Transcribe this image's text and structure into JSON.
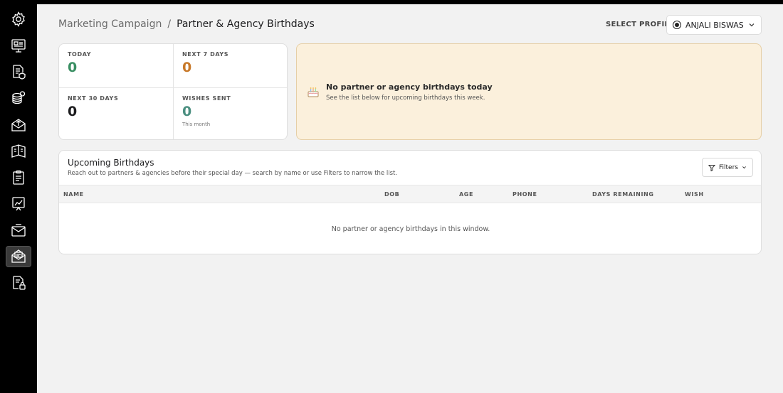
{
  "breadcrumb": {
    "parent": "Marketing Campaign",
    "separator": "/",
    "current": "Partner & Agency Birthdays"
  },
  "profile": {
    "label": "SELECT PROFILE",
    "selected": "ANJALI BISWAS"
  },
  "stats": {
    "today": {
      "label": "TODAY",
      "value": "0"
    },
    "next7": {
      "label": "NEXT 7 DAYS",
      "value": "0"
    },
    "next30": {
      "label": "NEXT 30 DAYS",
      "value": "0"
    },
    "wishes": {
      "label": "WISHES SENT",
      "value": "0",
      "sub": "This month"
    }
  },
  "banner": {
    "title": "No partner or agency birthdays today",
    "subtitle": "See the list below for upcoming birthdays this week."
  },
  "upcoming": {
    "title": "Upcoming Birthdays",
    "subtitle": "Reach out to partners & agencies before their special day — search by name or use Filters to narrow the list.",
    "filters_label": "Filters",
    "columns": [
      "NAME",
      "DOB",
      "AGE",
      "PHONE",
      "DAYS REMAINING",
      "WISH"
    ],
    "empty_message": "No partner or agency birthdays in this window."
  },
  "sidebar": {
    "items": [
      {
        "icon": "gear-icon"
      },
      {
        "icon": "monitor-icon"
      },
      {
        "icon": "document-shield-icon"
      },
      {
        "icon": "coins-icon"
      },
      {
        "icon": "mail-upload-icon"
      },
      {
        "icon": "report-book-icon"
      },
      {
        "icon": "clipboard-icon"
      },
      {
        "icon": "chart-board-icon"
      },
      {
        "icon": "envelope-icon"
      },
      {
        "icon": "mail-open-icon",
        "active": true
      },
      {
        "icon": "document-lock-icon"
      }
    ]
  },
  "colors": {
    "green": "#3a8f63",
    "orange": "#c8792a",
    "banner_bg": "#fbf0dc"
  }
}
